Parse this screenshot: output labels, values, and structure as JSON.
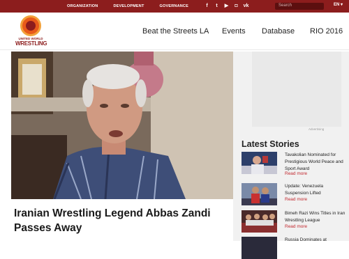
{
  "topbar": {
    "nav": [
      "ORGANIZATION",
      "DEVELOPMENT",
      "GOVERNANCE"
    ],
    "social_icons": [
      "facebook-icon",
      "twitter-icon",
      "youtube-icon",
      "instagram-icon",
      "vk-icon"
    ],
    "search_placeholder": "Search",
    "language": "EN ▾"
  },
  "logo": {
    "line1": "UNITED WORLD",
    "line2": "WRESTLING"
  },
  "main_nav": [
    "Beat the Streets LA",
    "Events",
    "Database",
    "RIO 2016"
  ],
  "hero": {
    "headline": "Iranian Wrestling Legend Abbas Zandi Passes Away"
  },
  "ad": {
    "label": "Advertising"
  },
  "sidebar": {
    "heading": "Latest Stories",
    "stories": [
      {
        "title": "Tavakolian Nominated for Prestigious World Peace and Sport Award",
        "more": "Read more"
      },
      {
        "title": "Update: Venezuela Suspension Lifted",
        "more": "Read more"
      },
      {
        "title": "Bimeh Razi Wins Titles in Iran Wrestling League",
        "more": "Read more"
      },
      {
        "title": "Russia Dominates at",
        "more": ""
      }
    ]
  },
  "colors": {
    "brand": "#8c1d1d",
    "accent": "#c1272d",
    "orange": "#e85a1a"
  }
}
